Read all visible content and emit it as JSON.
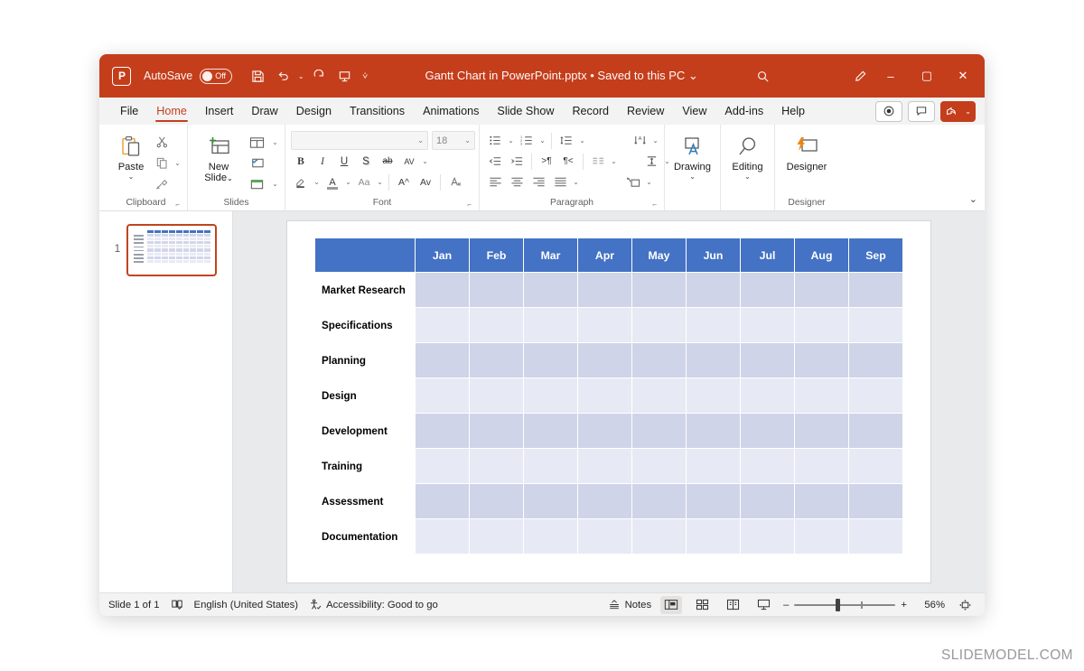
{
  "titlebar": {
    "logo": "P",
    "autosave_label": "AutoSave",
    "autosave_state": "Off",
    "document_title": "Gantt Chart in PowerPoint.pptx • Saved to this PC ⌄",
    "quick_access": [
      "save-icon",
      "undo-icon",
      "redo-icon",
      "present-icon",
      "customize-qat-icon"
    ],
    "search_icon": "search-icon",
    "ink_icon": "pen-icon",
    "minimize": "–",
    "maximize": "▢",
    "close": "✕",
    "accent_color": "#c43e1c"
  },
  "tabs": [
    {
      "label": "File",
      "active": false
    },
    {
      "label": "Home",
      "active": true
    },
    {
      "label": "Insert",
      "active": false
    },
    {
      "label": "Draw",
      "active": false
    },
    {
      "label": "Design",
      "active": false
    },
    {
      "label": "Transitions",
      "active": false
    },
    {
      "label": "Animations",
      "active": false
    },
    {
      "label": "Slide Show",
      "active": false
    },
    {
      "label": "Record",
      "active": false
    },
    {
      "label": "Review",
      "active": false
    },
    {
      "label": "View",
      "active": false
    },
    {
      "label": "Add-ins",
      "active": false
    },
    {
      "label": "Help",
      "active": false
    }
  ],
  "tabbar_right": {
    "record_icon": "record-circle-icon",
    "comments_icon": "comment-icon",
    "share_label": "",
    "share_icon": "share-icon",
    "share_chevron": "⌄"
  },
  "ribbon": {
    "groups": [
      {
        "name": "Clipboard",
        "label": "Clipboard",
        "dialog_launcher": "⌐",
        "paste_label": "Paste",
        "paste_chevron": "⌄",
        "items": [
          "cut-icon",
          "copy-icon",
          "format-painter-icon"
        ]
      },
      {
        "name": "Slides",
        "label": "Slides",
        "new_slide_label_line1": "New",
        "new_slide_label_line2": "Slide",
        "new_slide_chevron": "⌄",
        "items": [
          "layout-icon",
          "reset-icon",
          "section-icon"
        ]
      },
      {
        "name": "Font",
        "label": "Font",
        "dialog_launcher": "⌐",
        "font_name_value": "",
        "font_name_placeholder": "",
        "font_size_value": "18",
        "row1": [
          "B",
          "I",
          "U",
          "S",
          "ab",
          "AV"
        ],
        "row2": [
          "highlight-icon",
          "font-color-icon",
          "Aa",
          "A^",
          "Av",
          "clear-format-icon"
        ]
      },
      {
        "name": "Paragraph",
        "label": "Paragraph",
        "dialog_launcher": "⌐",
        "row1": [
          "bullets-icon",
          "numbering-icon",
          "line-spacing-icon",
          "text-direction-icon"
        ],
        "row2": [
          "decrease-indent-icon",
          "increase-indent-icon",
          "ltr-icon",
          "rtl-icon",
          "columns-icon",
          "align-text-icon"
        ],
        "row3": [
          "align-left-icon",
          "align-center-icon",
          "align-right-icon",
          "justify-icon",
          "smartart-icon"
        ]
      },
      {
        "name": "Drawing",
        "label": "",
        "caption": "Drawing",
        "chevron": "⌄"
      },
      {
        "name": "Editing",
        "label": "",
        "caption": "Editing",
        "chevron": "⌄"
      },
      {
        "name": "Designer",
        "label": "Designer",
        "caption": "Designer"
      }
    ],
    "collapse_chevron": "⌄"
  },
  "thumbnails": [
    {
      "number": "1",
      "selected": true
    }
  ],
  "chart_data": {
    "type": "table",
    "title": "Gantt Chart",
    "categories": [
      "Jan",
      "Feb",
      "Mar",
      "Apr",
      "May",
      "Jun",
      "Jul",
      "Aug",
      "Sep"
    ],
    "row_header": "",
    "rows": [
      {
        "task": "Market Research",
        "values": [
          "",
          "",
          "",
          "",
          "",
          "",
          "",
          "",
          ""
        ]
      },
      {
        "task": "Specifications",
        "values": [
          "",
          "",
          "",
          "",
          "",
          "",
          "",
          "",
          ""
        ]
      },
      {
        "task": "Planning",
        "values": [
          "",
          "",
          "",
          "",
          "",
          "",
          "",
          "",
          ""
        ]
      },
      {
        "task": "Design",
        "values": [
          "",
          "",
          "",
          "",
          "",
          "",
          "",
          "",
          ""
        ]
      },
      {
        "task": "Development",
        "values": [
          "",
          "",
          "",
          "",
          "",
          "",
          "",
          "",
          ""
        ]
      },
      {
        "task": "Training",
        "values": [
          "",
          "",
          "",
          "",
          "",
          "",
          "",
          "",
          ""
        ]
      },
      {
        "task": "Assessment",
        "values": [
          "",
          "",
          "",
          "",
          "",
          "",
          "",
          "",
          ""
        ]
      },
      {
        "task": "Documentation",
        "values": [
          "",
          "",
          "",
          "",
          "",
          "",
          "",
          "",
          ""
        ]
      }
    ],
    "header_color": "#4472c4",
    "band_a_color": "#d0d4e8",
    "band_b_color": "#e7eaf4",
    "header_text_color": "#ffffff"
  },
  "statusbar": {
    "slide_count": "Slide 1 of 1",
    "spellcheck_icon": "spellcheck-icon",
    "language": "English (United States)",
    "accessibility_icon": "accessibility-icon",
    "accessibility": "Accessibility: Good to go",
    "notes_label": "Notes",
    "notes_icon": "notes-icon",
    "views": [
      "normal-view-icon",
      "slide-sorter-icon",
      "reading-view-icon",
      "slideshow-icon"
    ],
    "zoom_out": "–",
    "zoom_in": "+",
    "zoom_level": "56%",
    "fit_slide_icon": "fit-to-window-icon"
  },
  "watermark": "SLIDEMODEL.COM"
}
